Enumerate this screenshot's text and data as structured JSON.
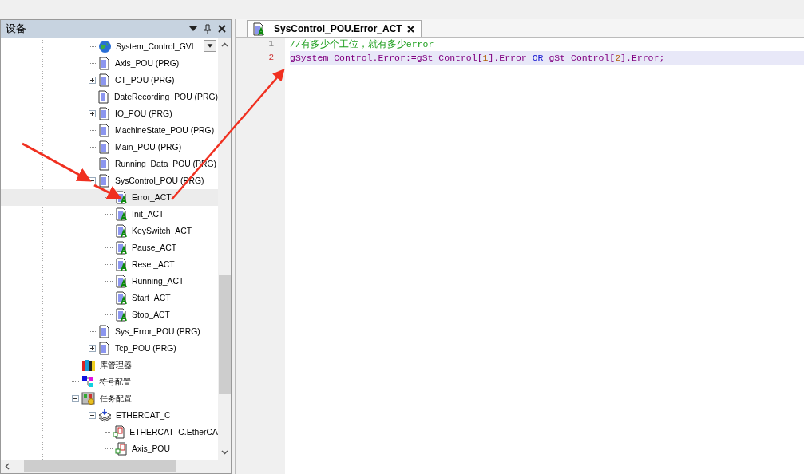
{
  "devices_panel": {
    "title": "设备",
    "tree": [
      {
        "children": [
          {
            "label": "System_Control_GVL",
            "kind": "gvl"
          },
          {
            "label": "Axis_POU (PRG)",
            "kind": "prg"
          },
          {
            "label": "CT_POU (PRG)",
            "kind": "prg",
            "expanded": false
          },
          {
            "label": "DateRecording_POU (PRG)",
            "kind": "prg"
          },
          {
            "label": "IO_POU (PRG)",
            "kind": "prg",
            "expanded": false
          },
          {
            "label": "MachineState_POU (PRG)",
            "kind": "prg"
          },
          {
            "label": "Main_POU (PRG)",
            "kind": "prg"
          },
          {
            "label": "Running_Data_POU (PRG)",
            "kind": "prg"
          },
          {
            "label": "SysControl_POU (PRG)",
            "kind": "prg",
            "expanded": true,
            "children": [
              {
                "label": "Error_ACT",
                "kind": "act",
                "selected": true
              },
              {
                "label": "Init_ACT",
                "kind": "act",
                "selected": false
              },
              {
                "label": "KeySwitch_ACT",
                "kind": "act",
                "selected": false
              },
              {
                "label": "Pause_ACT",
                "kind": "act",
                "selected": false
              },
              {
                "label": "Reset_ACT",
                "kind": "act",
                "selected": false
              },
              {
                "label": "Running_ACT",
                "kind": "act",
                "selected": false
              },
              {
                "label": "Start_ACT",
                "kind": "act",
                "selected": false
              },
              {
                "label": "Stop_ACT",
                "kind": "act",
                "selected": false
              }
            ]
          },
          {
            "label": "Sys_Error_POU (PRG)",
            "kind": "prg"
          },
          {
            "label": "Tcp_POU (PRG)",
            "kind": "prg",
            "expanded": false
          }
        ]
      },
      {
        "label": "库管理器",
        "kind": "library"
      },
      {
        "label": "符号配置",
        "kind": "symbol"
      },
      {
        "label": "任务配置",
        "kind": "task",
        "expanded": true,
        "children": [
          {
            "label": "ETHERCAT_C",
            "kind": "ethercat",
            "expanded": true,
            "children": [
              {
                "label": "ETHERCAT_C.EtherCA",
                "kind": "call"
              },
              {
                "label": "Axis_POU",
                "kind": "call"
              }
            ]
          }
        ]
      }
    ]
  },
  "editor": {
    "tab": {
      "label": "SysControl_POU.Error_ACT",
      "selected": true
    },
    "lines": [
      {
        "number": "1",
        "current": false,
        "tokens": [
          {
            "text": "//有多少个工位，就有多少error",
            "kind": "comment"
          }
        ]
      },
      {
        "number": "2",
        "current": true,
        "tokens": [
          {
            "text": "gSystem_Control.Error:=gSt_Control[",
            "kind": "ident"
          },
          {
            "text": "1",
            "kind": "number"
          },
          {
            "text": "].Error ",
            "kind": "ident"
          },
          {
            "text": "OR",
            "kind": "keyword"
          },
          {
            "text": " gSt_Control[",
            "kind": "ident"
          },
          {
            "text": "2",
            "kind": "number"
          },
          {
            "text": "].Error;",
            "kind": "ident"
          }
        ]
      }
    ]
  }
}
